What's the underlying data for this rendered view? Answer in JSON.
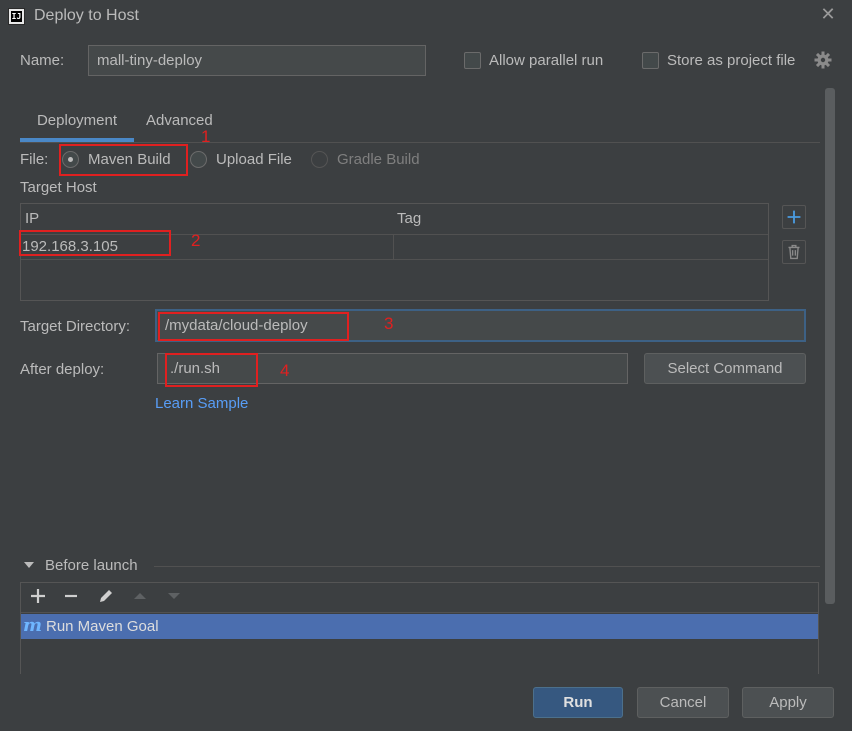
{
  "window": {
    "title": "Deploy to Host",
    "app_icon_text": "IJ",
    "close_glyph": "✕"
  },
  "name_row": {
    "label": "Name:",
    "value": "mall-tiny-deploy",
    "allow_parallel_label": "Allow parallel run",
    "allow_parallel_checked": false,
    "store_project_label": "Store as project file",
    "store_project_checked": false
  },
  "tabs": [
    {
      "label": "Deployment",
      "active": true
    },
    {
      "label": "Advanced",
      "active": false
    }
  ],
  "deployment": {
    "file_label": "File:",
    "file_options": [
      {
        "label": "Maven Build",
        "selected": true,
        "enabled": true
      },
      {
        "label": "Upload File",
        "selected": false,
        "enabled": true
      },
      {
        "label": "Gradle Build",
        "selected": false,
        "enabled": false
      }
    ],
    "target_host_label": "Target Host",
    "host_table": {
      "columns": [
        "IP",
        "Tag"
      ],
      "rows": [
        {
          "ip": "192.168.3.105",
          "tag": ""
        }
      ]
    },
    "target_directory_label": "Target Directory:",
    "target_directory_value": "/mydata/cloud-deploy",
    "after_deploy_label": "After deploy:",
    "after_deploy_value": "./run.sh",
    "select_command_label": "Select Command",
    "learn_sample_label": "Learn Sample"
  },
  "before_launch": {
    "label": "Before launch",
    "tools": [
      "add-icon",
      "remove-icon",
      "edit-icon",
      "move-up-icon",
      "move-down-icon"
    ],
    "items": [
      {
        "icon_text": "m",
        "label": "Run Maven Goal"
      }
    ]
  },
  "buttons": {
    "run": "Run",
    "cancel": "Cancel",
    "apply": "Apply"
  },
  "annotations": [
    "1",
    "2",
    "3",
    "4"
  ],
  "colors": {
    "background": "#3c3f41",
    "accent": "#4a88c7",
    "selection": "#4b6eaf",
    "link": "#589df6",
    "annotation": "#e02020",
    "primary_button": "#365880"
  }
}
